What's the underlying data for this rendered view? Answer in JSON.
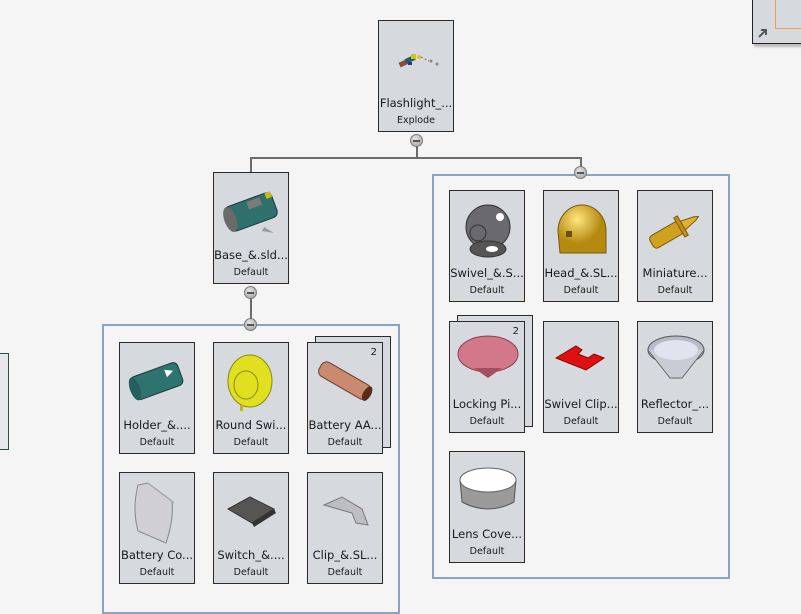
{
  "root": {
    "name": "Flashlight_...",
    "config": "Explode",
    "icon": "flashlight-assembly-exploded-icon"
  },
  "base": {
    "name": "Base_&.sld...",
    "config": "Default",
    "icon": "base-housing-icon"
  },
  "left_group": [
    {
      "name": "Holder_&....",
      "config": "Default",
      "icon": "holder-part-icon"
    },
    {
      "name": "Round Swi...",
      "config": "Default",
      "icon": "round-switch-part-icon"
    },
    {
      "name": "Battery AA...",
      "config": "Default",
      "quantity": "2",
      "icon": "battery-aa-part-icon"
    },
    {
      "name": "Battery Co...",
      "config": "Default",
      "icon": "battery-cover-part-icon"
    },
    {
      "name": "Switch_&....",
      "config": "Default",
      "icon": "switch-part-icon"
    },
    {
      "name": "Clip_&.SL...",
      "config": "Default",
      "icon": "clip-part-icon"
    }
  ],
  "right_group": [
    {
      "name": "Swivel_&.S...",
      "config": "Default",
      "icon": "swivel-part-icon"
    },
    {
      "name": "Head_&.SL...",
      "config": "Default",
      "icon": "head-part-icon"
    },
    {
      "name": "Miniature...",
      "config": "Default",
      "icon": "miniature-bulb-part-icon"
    },
    {
      "name": "Locking Pi...",
      "config": "Default",
      "quantity": "2",
      "icon": "locking-pin-part-icon"
    },
    {
      "name": "Swivel Clip...",
      "config": "Default",
      "icon": "swivel-clip-part-icon"
    },
    {
      "name": "Reflector_...",
      "config": "Default",
      "icon": "reflector-part-icon"
    },
    {
      "name": "Lens Cove...",
      "config": "Default",
      "icon": "lens-cover-part-icon"
    }
  ],
  "colors": {
    "group_border": "#8aa4c4",
    "node_bg": "#d6d9de",
    "canvas_bg": "#f5f5f5"
  }
}
